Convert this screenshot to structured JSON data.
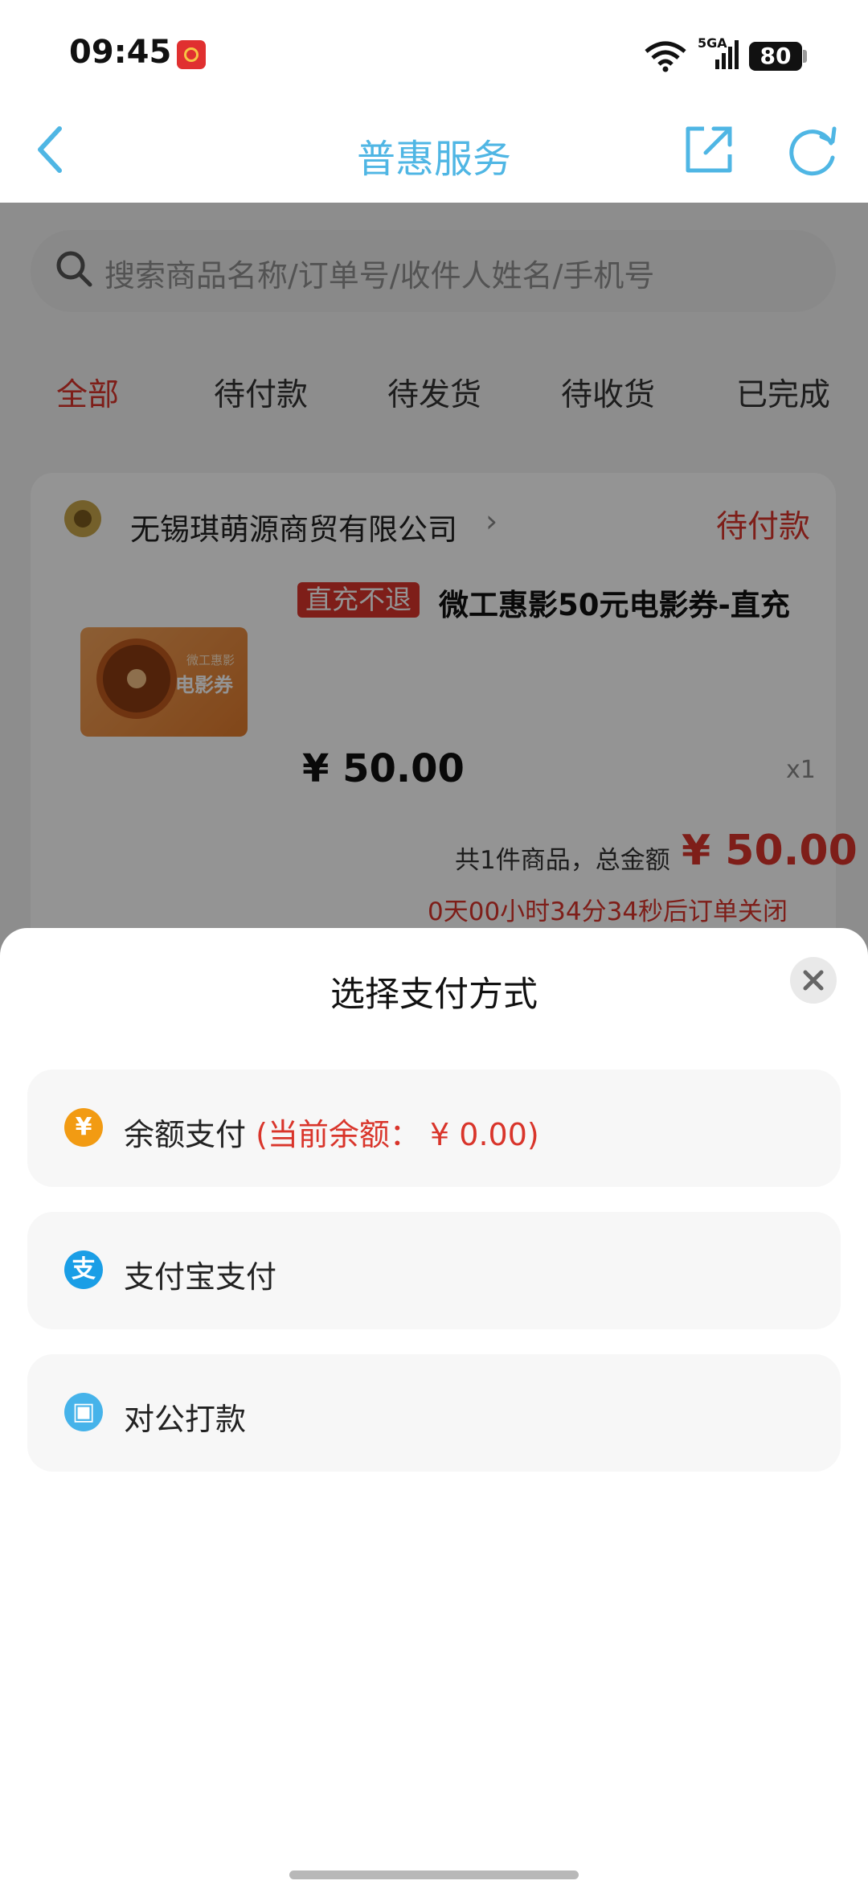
{
  "status_bar": {
    "time": "09:45",
    "network": "5GA",
    "battery": "80"
  },
  "nav": {
    "title": "普惠服务",
    "back_icon": "chevron-left-icon",
    "share_icon": "share-icon",
    "refresh_icon": "refresh-icon"
  },
  "search": {
    "placeholder": "搜索商品名称/订单号/收件人姓名/手机号"
  },
  "tabs": [
    {
      "label": "全部",
      "active": true
    },
    {
      "label": "待付款",
      "active": false
    },
    {
      "label": "待发货",
      "active": false
    },
    {
      "label": "待收货",
      "active": false
    },
    {
      "label": "已完成",
      "active": false
    }
  ],
  "order": {
    "shop_name": "无锡琪萌源商贸有限公司",
    "status": "待付款",
    "badge": "直充不退",
    "product_title": "微工惠影50元电影券-直充",
    "image_small": "微工惠影",
    "image_label": "电影券",
    "price": "¥ 50.00",
    "quantity": "x1",
    "summary": "共1件商品，总金额",
    "total": "¥ 50.00",
    "countdown": "0天00小时34分34秒后订单关闭"
  },
  "payment_sheet": {
    "title": "选择支付方式",
    "options": [
      {
        "label": "余额支付",
        "note": "(当前余额： ¥ 0.00)",
        "icon": "yuan-icon",
        "icon_glyph": "¥"
      },
      {
        "label": "支付宝支付",
        "note": "",
        "icon": "alipay-icon",
        "icon_glyph": "支"
      },
      {
        "label": "对公打款",
        "note": "",
        "icon": "wallet-icon",
        "icon_glyph": "▣"
      }
    ]
  },
  "colors": {
    "accent_blue": "#4fb6e4",
    "accent_red": "#d9352b",
    "balance_orange": "#f29b13",
    "alipay_blue": "#1a9ee6"
  }
}
